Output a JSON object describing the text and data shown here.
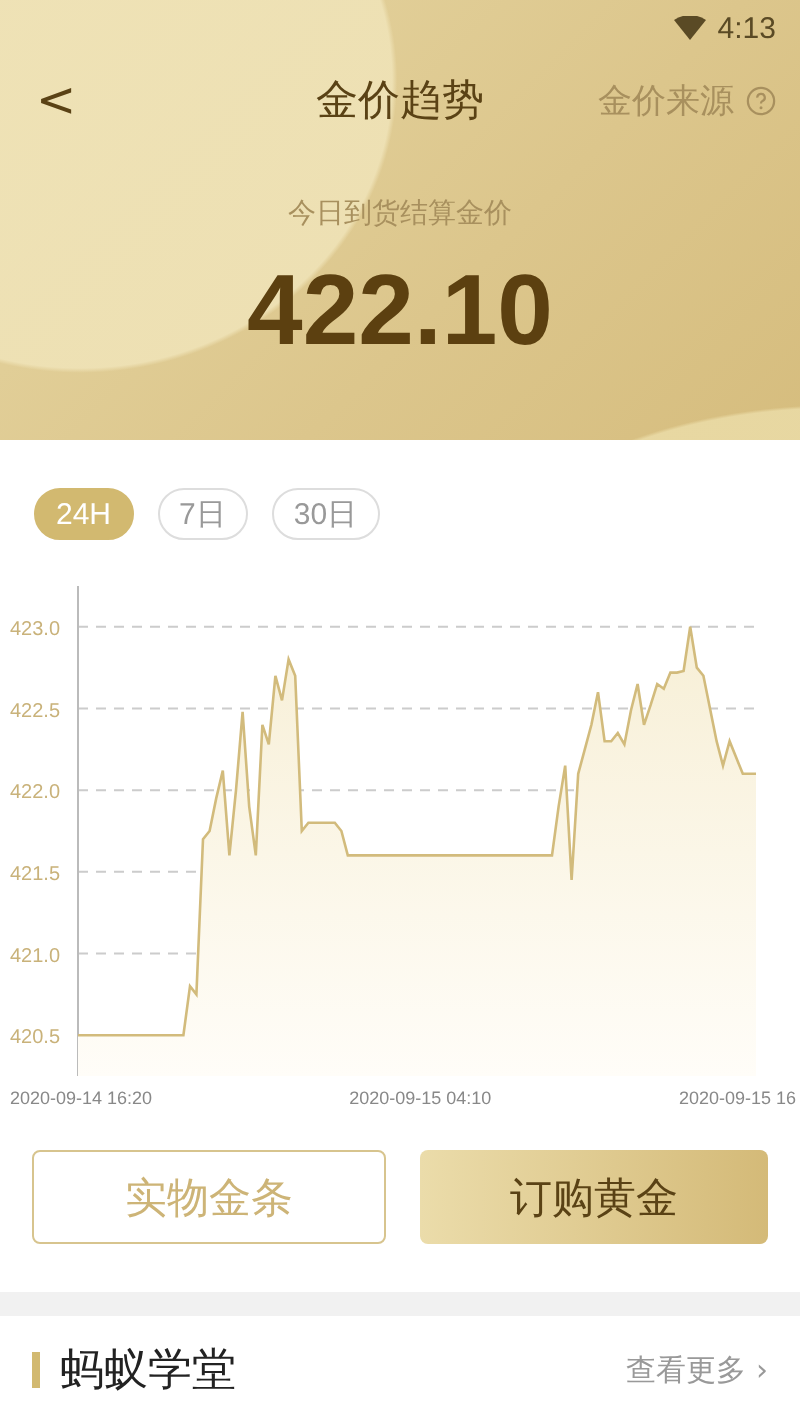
{
  "status_bar": {
    "time": "4:13"
  },
  "nav": {
    "back": "<",
    "title": "金价趋势",
    "source_link": "金价来源"
  },
  "price": {
    "caption": "今日到货结算金价",
    "value": "422.10"
  },
  "ranges": [
    {
      "label": "24H",
      "selected": true
    },
    {
      "label": "7日",
      "selected": false
    },
    {
      "label": "30日",
      "selected": false
    }
  ],
  "chart_data": {
    "type": "area",
    "categories": [
      "2020-09-14 16:20",
      null,
      null,
      null,
      null,
      null,
      null,
      null,
      null,
      null,
      null,
      null,
      null,
      null,
      null,
      null,
      null,
      null,
      null,
      null,
      null,
      null,
      null,
      null,
      null,
      null,
      null,
      null,
      null,
      null,
      null,
      null,
      null,
      null,
      null,
      null,
      null,
      null,
      null,
      null,
      null,
      null,
      null,
      null,
      null,
      null,
      null,
      null,
      null,
      null,
      null,
      null,
      "2020-09-15 04:10",
      null,
      null,
      null,
      null,
      null,
      null,
      null,
      null,
      null,
      null,
      null,
      null,
      null,
      null,
      null,
      null,
      null,
      null,
      null,
      null,
      null,
      null,
      null,
      null,
      null,
      null,
      null,
      null,
      null,
      null,
      null,
      null,
      null,
      null,
      null,
      null,
      null,
      null,
      null,
      null,
      null,
      null,
      null,
      null,
      null,
      null,
      null,
      "2020-09-15 16",
      null,
      null,
      null
    ],
    "series": [
      {
        "color": "#d2bb7c",
        "values": [
          420.5,
          420.5,
          420.5,
          420.5,
          420.5,
          420.5,
          420.5,
          420.5,
          420.5,
          420.5,
          420.5,
          420.5,
          420.5,
          420.5,
          420.5,
          420.5,
          420.5,
          420.8,
          420.75,
          421.7,
          421.75,
          421.95,
          422.12,
          421.6,
          422.0,
          422.48,
          421.9,
          421.6,
          422.4,
          422.28,
          422.7,
          422.55,
          422.8,
          422.7,
          421.75,
          421.8,
          421.8,
          421.8,
          421.8,
          421.8,
          421.75,
          421.6,
          421.6,
          421.6,
          421.6,
          421.6,
          421.6,
          421.6,
          421.6,
          421.6,
          421.6,
          421.6,
          421.6,
          421.6,
          421.6,
          421.6,
          421.6,
          421.6,
          421.6,
          421.6,
          421.6,
          421.6,
          421.6,
          421.6,
          421.6,
          421.6,
          421.6,
          421.6,
          421.6,
          421.6,
          421.6,
          421.6,
          421.6,
          421.9,
          422.15,
          421.45,
          422.1,
          422.25,
          422.4,
          422.6,
          422.3,
          422.3,
          422.35,
          422.28,
          422.49,
          422.65,
          422.4,
          422.52,
          422.65,
          422.62,
          422.72,
          422.72,
          422.73,
          423.0,
          422.75,
          422.7,
          422.5,
          422.3,
          422.15,
          422.3,
          422.2,
          422.1,
          422.1,
          422.1
        ]
      }
    ],
    "grid": true,
    "ylim": [
      420.25,
      423.25
    ],
    "yticks": [
      {
        "value": 423.0,
        "label": "423.0"
      },
      {
        "value": 422.5,
        "label": "422.5"
      },
      {
        "value": 422.0,
        "label": "422.0"
      },
      {
        "value": 421.5,
        "label": "421.5"
      },
      {
        "value": 421.0,
        "label": "421.0"
      },
      {
        "value": 420.5,
        "label": "420.5"
      }
    ]
  },
  "actions": [
    {
      "label": "实物金条",
      "kind": "outline"
    },
    {
      "label": "订购黄金",
      "kind": "filled"
    }
  ],
  "section": {
    "title": "蚂蚁学堂",
    "more": "查看更多",
    "more_arrow": "›"
  }
}
